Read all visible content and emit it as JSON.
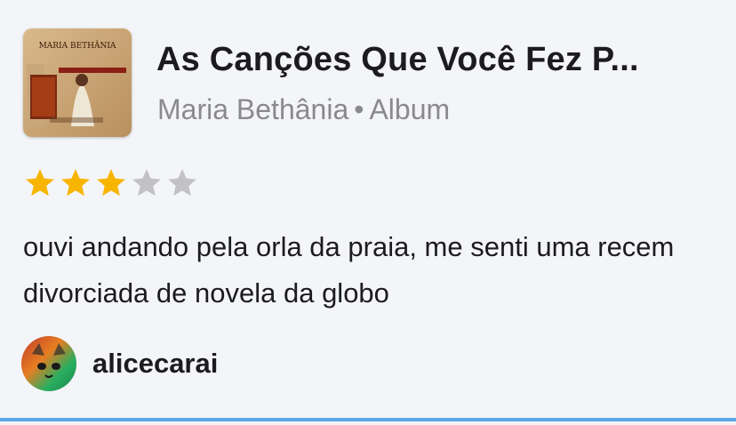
{
  "album": {
    "cover_name": "album-cover",
    "cover_text": "MARIA BETHÂNIA",
    "title": "As Canções Que Você Fez P...",
    "artist": "Maria Bethânia",
    "separator": "•",
    "kind": "Album"
  },
  "rating": {
    "value": 3,
    "max": 5,
    "filled_color": "#f7b500",
    "empty_color": "#c2c2c6"
  },
  "review": {
    "text": "ouvi andando pela orla da praia, me senti uma recem divorciada de novela da globo"
  },
  "user": {
    "username": "alicecarai"
  }
}
